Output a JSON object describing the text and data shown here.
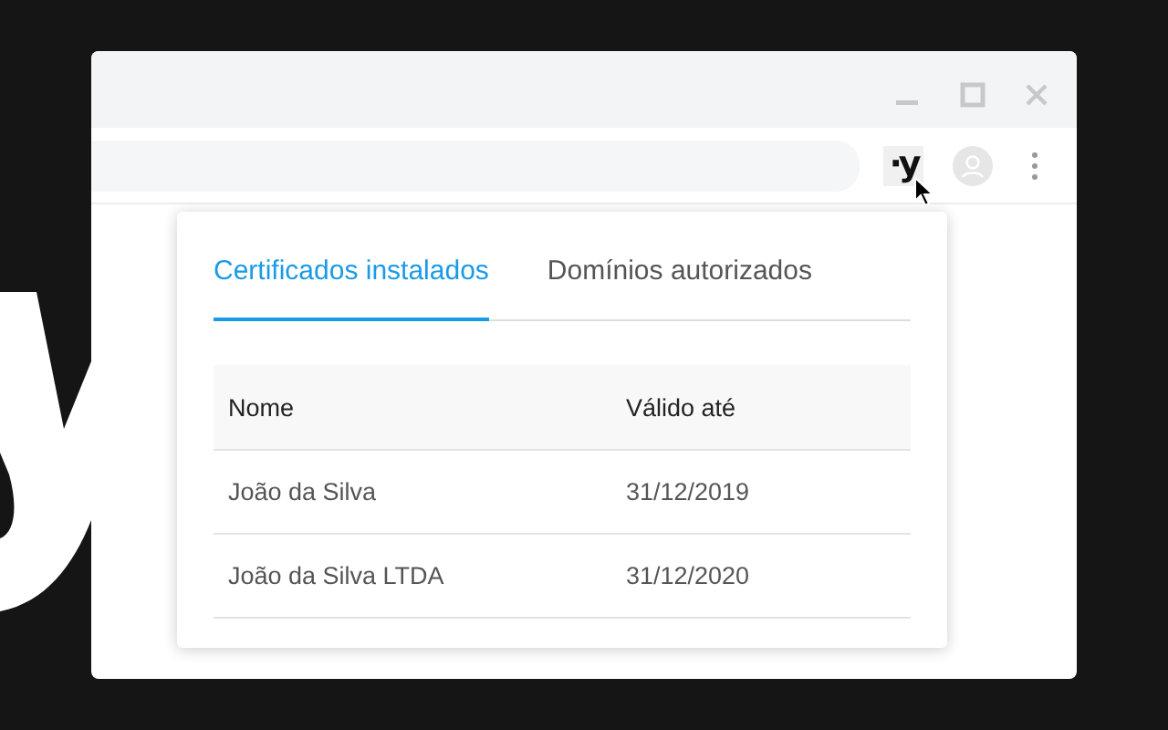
{
  "toolbar": {
    "extension_label": "·y"
  },
  "popup": {
    "tabs": [
      {
        "label": "Certificados instalados",
        "selected": true
      },
      {
        "label": "Domínios autorizados",
        "selected": false
      }
    ],
    "table": {
      "columns": [
        "Nome",
        "Válido até"
      ],
      "rows": [
        [
          "João da Silva",
          "31/12/2019"
        ],
        [
          "João da Silva LTDA",
          "31/12/2020"
        ]
      ]
    }
  }
}
